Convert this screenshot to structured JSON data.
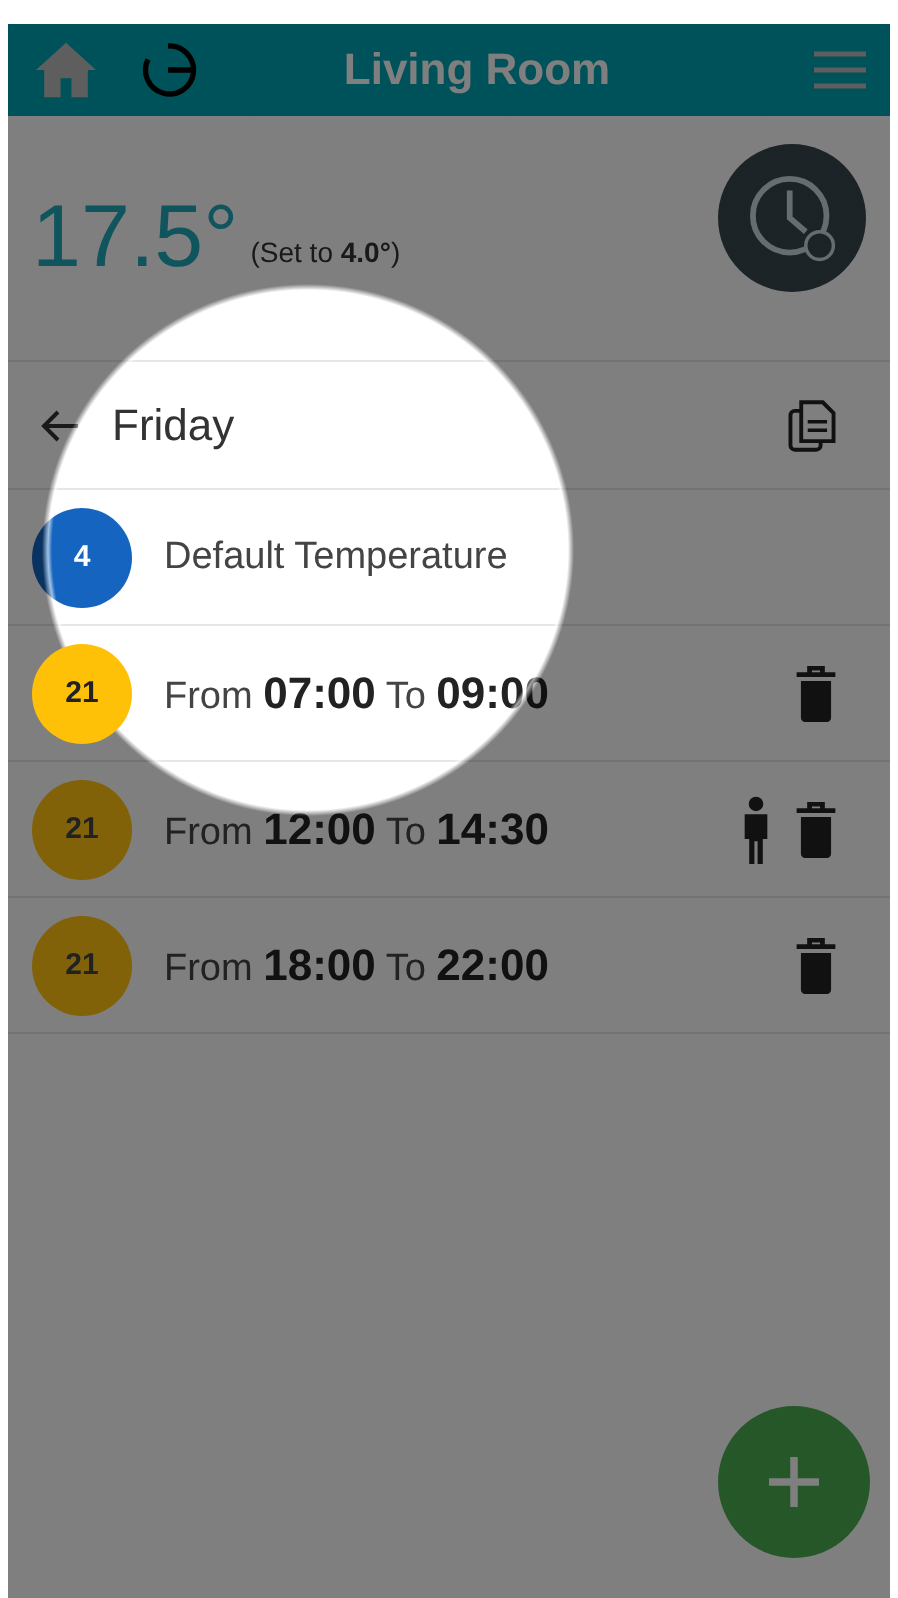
{
  "header": {
    "title": "Living Room"
  },
  "status": {
    "temperature": "17.5°",
    "setpoint": "(Set to **4.0°**)"
  },
  "day": {
    "name": "Friday"
  },
  "default": {
    "value": "4",
    "label": "Default Temperature",
    "color": "#1565c0"
  },
  "periods": [
    {
      "value": "21",
      "color": "#ffc107",
      "label": "From **07:00** To **09:00**",
      "occupancy": false
    },
    {
      "value": "21",
      "color": "#826208",
      "label": "From **12:00** To **14:30**",
      "occupancy": true
    },
    {
      "value": "21",
      "color": "#826208",
      "label": "From **18:00** To **22:00**",
      "occupancy": false
    }
  ]
}
